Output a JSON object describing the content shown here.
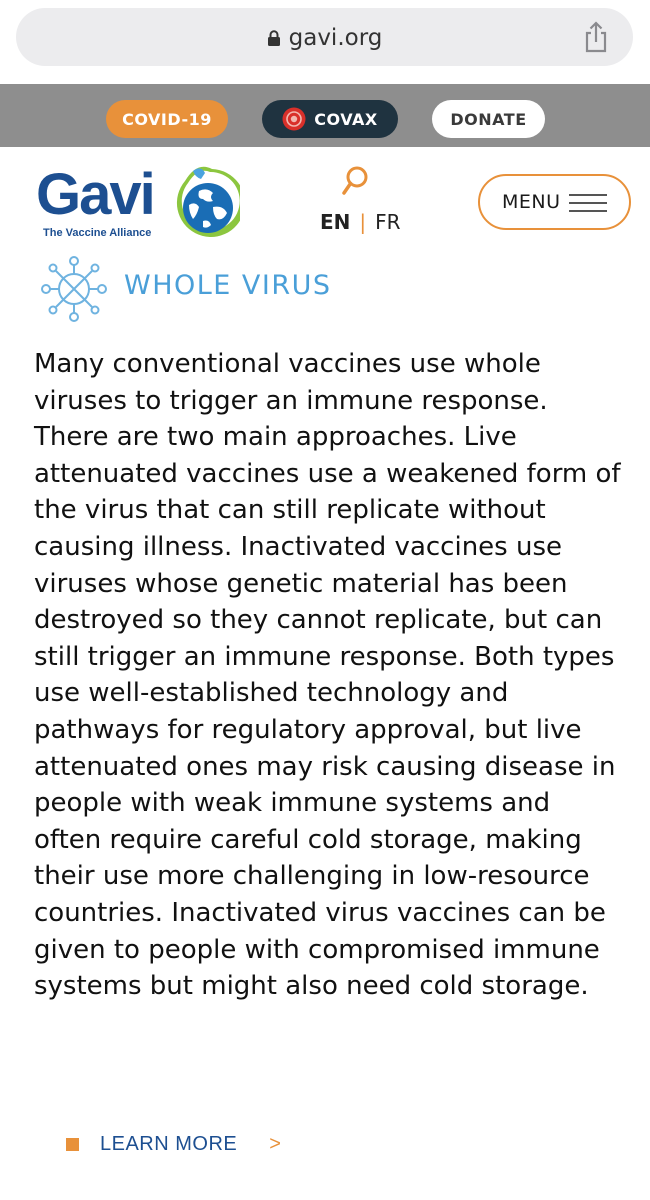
{
  "browser": {
    "url": "gavi.org",
    "lock_icon": "lock-icon",
    "share_icon": "share-icon"
  },
  "topbar": {
    "covid_label": "COVID-19",
    "covax_label": "COVAX",
    "donate_label": "DONATE",
    "colors": {
      "orange": "#e8913a",
      "dark": "#1f3340",
      "bar": "#8e8e8e"
    }
  },
  "header": {
    "logo_text": "Gavi",
    "logo_tagline": "The Vaccine Alliance",
    "search_icon": "search-icon",
    "lang_active": "EN",
    "lang_separator": "|",
    "lang_other": "FR",
    "menu_label": "MENU",
    "menu_icon": "hamburger-icon"
  },
  "section": {
    "icon": "virus-icon",
    "title": "WHOLE VIRUS",
    "body": "Many conventional vaccines use whole viruses to trigger an immune response. There are two main approaches. Live attenuated vaccines use a weakened form of the virus that can still replicate without causing illness. Inactivated vaccines use viruses whose genetic material has been destroyed so they cannot replicate, but can still trigger an immune response. Both types use well-established technology and pathways for regulatory approval, but live attenuated ones may risk causing disease in people with weak immune systems and often require careful cold storage, making their use more challenging in low-resource countries. Inactivated virus vaccines can be given to people with compromised immune systems but might also need cold storage.",
    "title_color": "#4a9fd8"
  },
  "learn_more": {
    "label": "LEARN MORE",
    "arrow": ">"
  }
}
